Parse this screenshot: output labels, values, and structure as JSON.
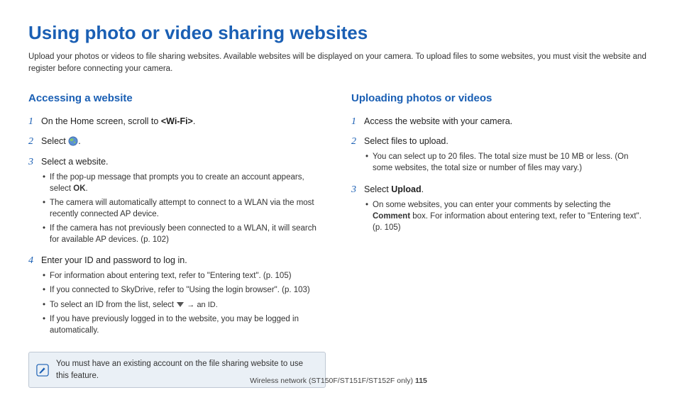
{
  "title": "Using photo or video sharing websites",
  "intro": "Upload your photos or videos to file sharing websites. Available websites will be displayed on your camera. To upload files to some websites, you must visit the website and register before connecting your camera.",
  "left": {
    "heading": "Accessing a website",
    "step1_a": "On the Home screen, scroll to ",
    "step1_b": "<Wi-Fi>",
    "step1_c": ".",
    "step2_a": "Select ",
    "step2_b": ".",
    "step3_text": "Select a website.",
    "step3_bul1a": "If the pop-up message that prompts you to create an account appears, select ",
    "step3_bul1b": "OK",
    "step3_bul1c": ".",
    "step3_bul2": "The camera will automatically attempt to connect to a WLAN via the most recently connected AP device.",
    "step3_bul3": "If the camera has not previously been connected to a WLAN, it will search for available AP devices. (p. 102)",
    "step4_text": "Enter your ID and password to log in.",
    "step4_bul1": "For information about entering text, refer to \"Entering text\". (p. 105)",
    "step4_bul2": "If you connected to SkyDrive, refer to \"Using the login browser\". (p. 103)",
    "step4_bul3a": "To select an ID from the list, select ",
    "step4_bul3b": " → an ID.",
    "step4_bul4": "If you have previously logged in to the website, you may be logged in automatically.",
    "note": "You must have an existing account on the file sharing website to use this feature."
  },
  "right": {
    "heading": "Uploading photos or videos",
    "step1": "Access the website with your camera.",
    "step2_text": "Select files to upload.",
    "step2_bul1": "You can select up to 20 files. The total size must be 10 MB or less. (On some websites, the total size or number of files may vary.)",
    "step3_a": "Select ",
    "step3_b": "Upload",
    "step3_c": ".",
    "step3_bul1a": "On some websites, you can enter your comments by selecting the ",
    "step3_bul1b": "Comment",
    "step3_bul1c": " box. For information about entering text, refer to \"Entering text\". (p. 105)"
  },
  "footer_a": "Wireless network  (ST150F/ST151F/ST152F only)  ",
  "footer_b": "115"
}
